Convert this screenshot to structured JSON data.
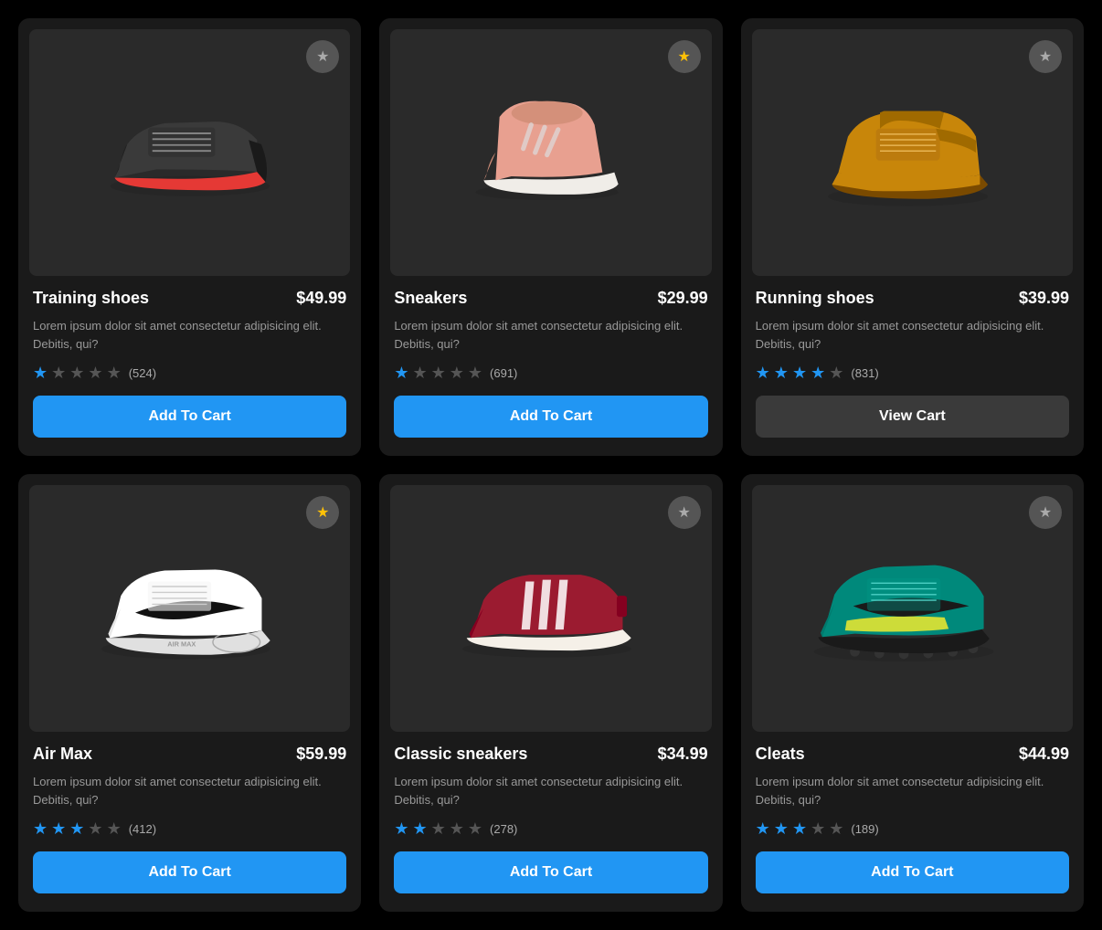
{
  "products": [
    {
      "id": "training-shoes",
      "title": "Training shoes",
      "price": "$49.99",
      "description": "Lorem ipsum dolor sit amet consectetur adipisicing elit. Debitis, qui?",
      "rating": 1,
      "ratingMax": 5,
      "ratingCount": "(524)",
      "button": "Add To Cart",
      "buttonType": "add",
      "favorited": false,
      "favoriteColor": "gray",
      "shoeColor1": "#3a3a3a",
      "shoeColor2": "#e53935",
      "shoeType": "training"
    },
    {
      "id": "sneakers",
      "title": "Sneakers",
      "price": "$29.99",
      "description": "Lorem ipsum dolor sit amet consectetur adipisicing elit. Debitis, qui?",
      "rating": 1,
      "ratingMax": 5,
      "ratingCount": "(691)",
      "button": "Add To Cart",
      "buttonType": "add",
      "favorited": true,
      "favoriteColor": "gold",
      "shoeColor1": "#e8a090",
      "shoeColor2": "#fff",
      "shoeType": "sneaker"
    },
    {
      "id": "running-shoes",
      "title": "Running shoes",
      "price": "$39.99",
      "description": "Lorem ipsum dolor sit amet consectetur adipisicing elit. Debitis, qui?",
      "rating": 4,
      "ratingMax": 5,
      "ratingCount": "(831)",
      "button": "View Cart",
      "buttonType": "view",
      "favorited": false,
      "favoriteColor": "gray",
      "shoeColor1": "#c8860a",
      "shoeColor2": "#a06000",
      "shoeType": "running"
    },
    {
      "id": "air-max",
      "title": "Air Max",
      "price": "$59.99",
      "description": "Lorem ipsum dolor sit amet consectetur adipisicing elit. Debitis, qui?",
      "rating": 3,
      "ratingMax": 5,
      "ratingCount": "(412)",
      "button": "Add To Cart",
      "buttonType": "add",
      "favorited": true,
      "favoriteColor": "gold",
      "shoeColor1": "#fff",
      "shoeColor2": "#111",
      "shoeType": "airmax"
    },
    {
      "id": "classic-sneakers",
      "title": "Classic sneakers",
      "price": "$34.99",
      "description": "Lorem ipsum dolor sit amet consectetur adipisicing elit. Debitis, qui?",
      "rating": 2,
      "ratingMax": 5,
      "ratingCount": "(278)",
      "button": "Add To Cart",
      "buttonType": "add",
      "favorited": false,
      "favoriteColor": "gray",
      "shoeColor1": "#9b1b30",
      "shoeColor2": "#fff",
      "shoeType": "classic"
    },
    {
      "id": "cleats",
      "title": "Cleats",
      "price": "$44.99",
      "description": "Lorem ipsum dolor sit amet consectetur adipisicing elit. Debitis, qui?",
      "rating": 3,
      "ratingMax": 5,
      "ratingCount": "(189)",
      "button": "Add To Cart",
      "buttonType": "add",
      "favorited": false,
      "favoriteColor": "gray",
      "shoeColor1": "#00897B",
      "shoeColor2": "#CDDC39",
      "shoeType": "cleats"
    }
  ],
  "labels": {
    "addToCart": "Add To Cart",
    "viewCart": "View Cart",
    "favoriteStar": "★"
  }
}
